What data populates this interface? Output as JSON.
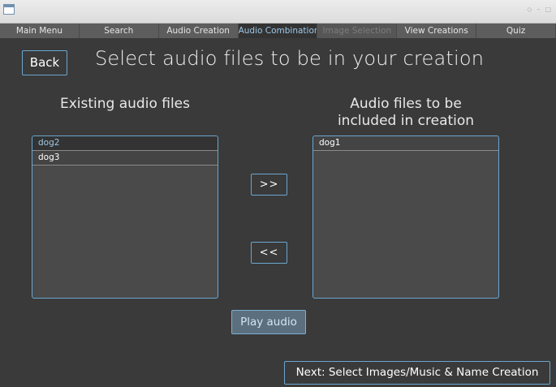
{
  "window": {
    "controls": [
      "◇",
      "–",
      "□"
    ]
  },
  "tabs": [
    {
      "label": "Main Menu",
      "state": "normal"
    },
    {
      "label": "Search",
      "state": "normal"
    },
    {
      "label": "Audio Creation",
      "state": "normal"
    },
    {
      "label": "Audio Combination",
      "state": "active"
    },
    {
      "label": "Image Selection",
      "state": "disabled"
    },
    {
      "label": "View Creations",
      "state": "normal"
    },
    {
      "label": "Quiz",
      "state": "normal"
    }
  ],
  "header": {
    "back_label": "Back",
    "title": "Select audio files to be in your creation"
  },
  "existing": {
    "heading": "Existing audio files",
    "items": [
      {
        "label": "dog2",
        "selected": true
      },
      {
        "label": "dog3",
        "selected": false
      }
    ]
  },
  "included": {
    "heading_line1": "Audio files to be",
    "heading_line2": "included in creation",
    "items": [
      {
        "label": "dog1",
        "selected": false
      }
    ]
  },
  "controls": {
    "add_label": ">>",
    "remove_label": "<<",
    "play_label": "Play audio",
    "next_label": "Next: Select Images/Music & Name Creation"
  },
  "colors": {
    "background": "#3a3a3a",
    "accent": "#6aa6cf",
    "active_tab_text": "#9ec8e8"
  }
}
